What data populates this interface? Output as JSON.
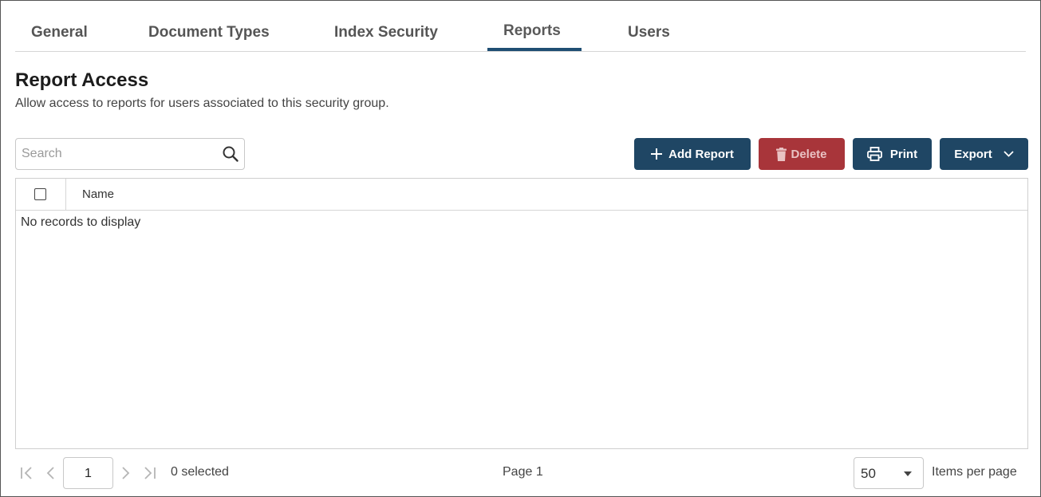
{
  "tabs": [
    {
      "label": "General"
    },
    {
      "label": "Document Types"
    },
    {
      "label": "Index Security"
    },
    {
      "label": "Reports",
      "active": true
    },
    {
      "label": "Users"
    }
  ],
  "section": {
    "title": "Report Access",
    "description": "Allow access to reports for users associated to this security group."
  },
  "search": {
    "placeholder": "Search",
    "value": "",
    "icon": "search-icon"
  },
  "toolbar": {
    "add_label": "Add Report",
    "delete_label": "Delete",
    "print_label": "Print",
    "export_label": "Export"
  },
  "grid": {
    "columns": [
      "Name"
    ],
    "empty_message": "No records to display"
  },
  "pager": {
    "current_page": "1",
    "selected_text": "0 selected",
    "page_text": "Page 1",
    "items_per_page": "50",
    "items_per_page_label": "Items per page"
  },
  "colors": {
    "primary": "#1f4664",
    "delete": "#a8353a",
    "tab_underline": "#1f4e73"
  }
}
